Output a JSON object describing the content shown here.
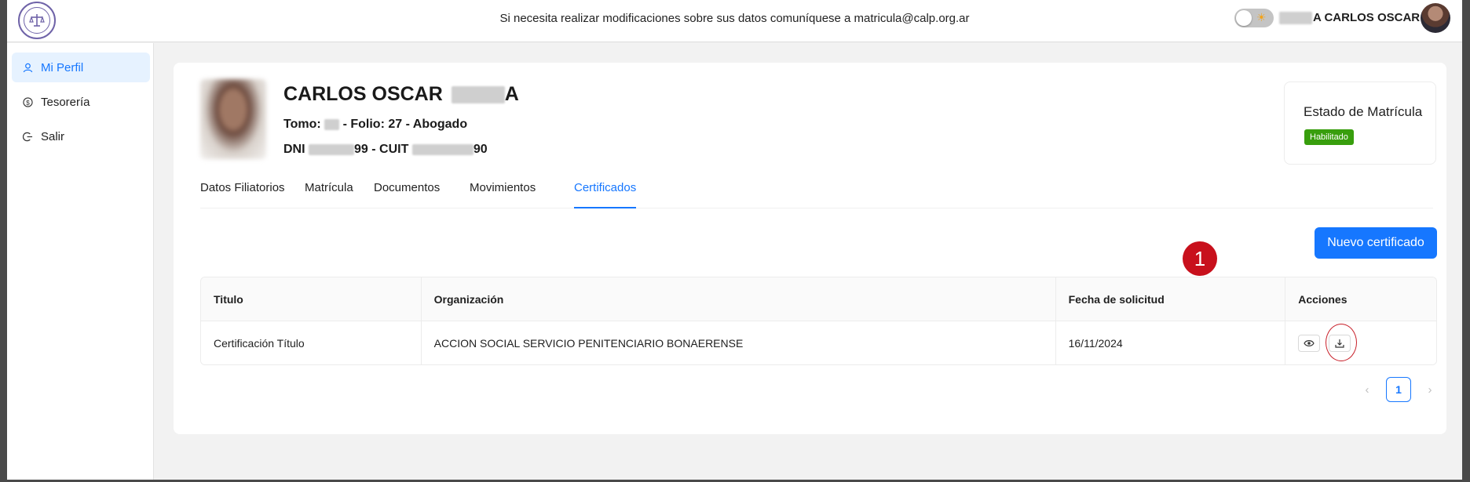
{
  "header": {
    "notice": "Si necesita realizar modificaciones sobre sus datos comuníquese a matricula@calp.org.ar",
    "user_name_visible": "A CARLOS OSCAR",
    "theme_icon": "sun-icon",
    "logo_alt": "colegio-de-abogados-logo"
  },
  "sidebar": {
    "items": [
      {
        "label": "Mi Perfil",
        "icon": "user-icon",
        "active": true
      },
      {
        "label": "Tesorería",
        "icon": "dollar-icon",
        "active": false
      },
      {
        "label": "Salir",
        "icon": "logout-icon",
        "active": false
      }
    ]
  },
  "profile": {
    "name": "CARLOS OSCAR",
    "name_suffix": "A",
    "tomo_label": "Tomo:",
    "folio_text": "- Folio: 27 - Abogado",
    "dni_label": "DNI",
    "dni_suffix": "99 - CUIT",
    "cuit_suffix": "90"
  },
  "estado": {
    "title": "Estado de Matrícula",
    "badge": "Habilitado",
    "badge_color": "#389e0d"
  },
  "tabs": [
    {
      "label": "Datos Filiatorios",
      "active": false
    },
    {
      "label": "Matrícula",
      "active": false
    },
    {
      "label": "Documentos",
      "active": false
    },
    {
      "label": "Movimientos",
      "active": false
    },
    {
      "label": "Certificados",
      "active": true
    }
  ],
  "actions": {
    "new_certificate": "Nuevo certificado"
  },
  "table": {
    "columns": [
      "Titulo",
      "Organización",
      "Fecha de solicitud",
      "Acciones"
    ],
    "rows": [
      {
        "titulo": "Certificación Título",
        "organizacion": "ACCION SOCIAL SERVICIO PENITENCIARIO BONAERENSE",
        "fecha": "16/11/2024"
      }
    ]
  },
  "pagination": {
    "current": "1",
    "prev": "‹",
    "next": "›"
  },
  "annotation": {
    "label": "1",
    "color": "#c8101c"
  },
  "colors": {
    "accent": "#1677ff",
    "sidebar_active_bg": "#e6f2ff"
  }
}
